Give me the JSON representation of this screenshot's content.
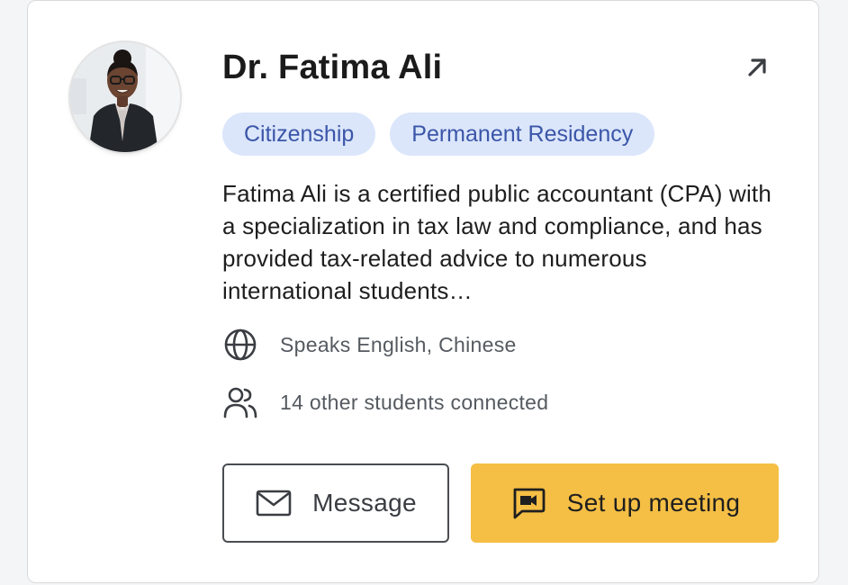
{
  "advisor": {
    "name": "Dr. Fatima Ali",
    "avatar_alt": "Dr. Fatima Ali"
  },
  "tags": [
    {
      "label": "Citizenship"
    },
    {
      "label": "Permanent Residency"
    }
  ],
  "bio": "Fatima Ali is a certified public accountant (CPA) with a specialization in tax law and compliance, and has provided tax-related advice to numerous international students…",
  "languages": {
    "text": "Speaks English, Chinese",
    "icon": "globe-icon"
  },
  "connections": {
    "text": "14 other students connected",
    "icon": "users-icon"
  },
  "actions": {
    "message_label": "Message",
    "message_icon": "mail-icon",
    "meeting_label": "Set up meeting",
    "meeting_icon": "video-chat-icon",
    "open_icon": "arrow-up-right-icon"
  },
  "colors": {
    "tag_bg": "#dbe6fb",
    "tag_text": "#3b56a8",
    "primary_button": "#f5bf45"
  }
}
